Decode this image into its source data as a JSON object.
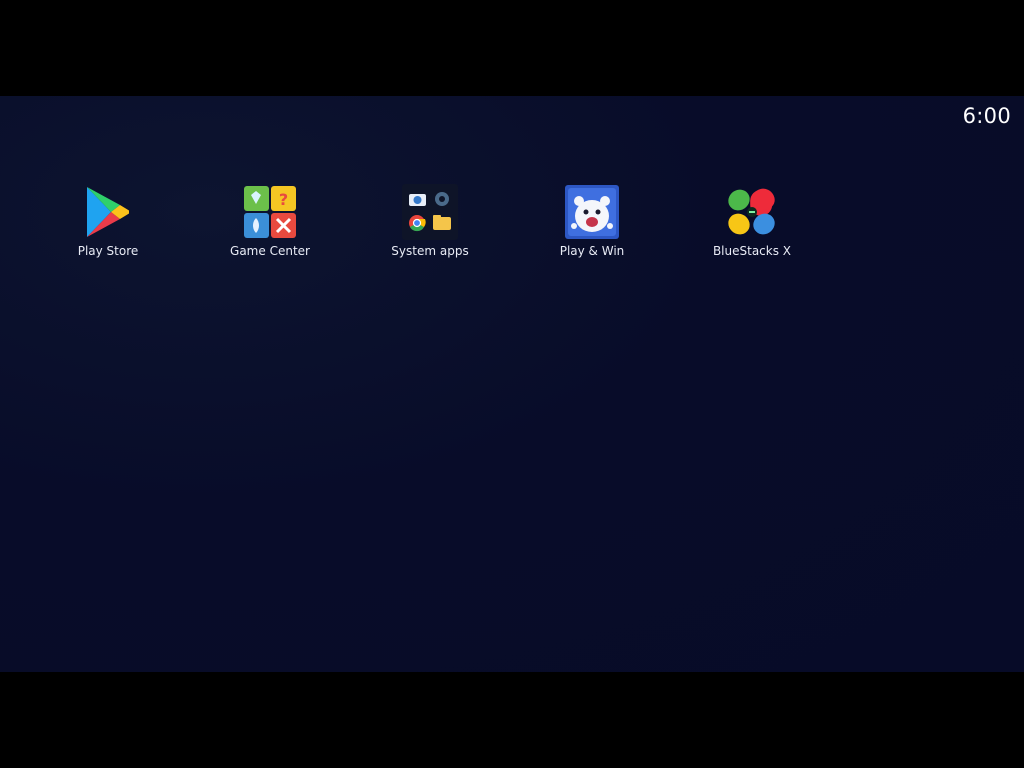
{
  "status_bar": {
    "time": "6:00"
  },
  "apps": [
    {
      "label": "Play Store",
      "icon": "play-store-icon"
    },
    {
      "label": "Game Center",
      "icon": "game-center-icon"
    },
    {
      "label": "System apps",
      "icon": "system-apps-folder-icon"
    },
    {
      "label": "Play & Win",
      "icon": "play-and-win-icon"
    },
    {
      "label": "BlueStacks X",
      "icon": "bluestacks-x-icon"
    }
  ],
  "colors": {
    "background": "#080c29",
    "letterbox": "#000000",
    "label_text": "#e8ebf5"
  }
}
